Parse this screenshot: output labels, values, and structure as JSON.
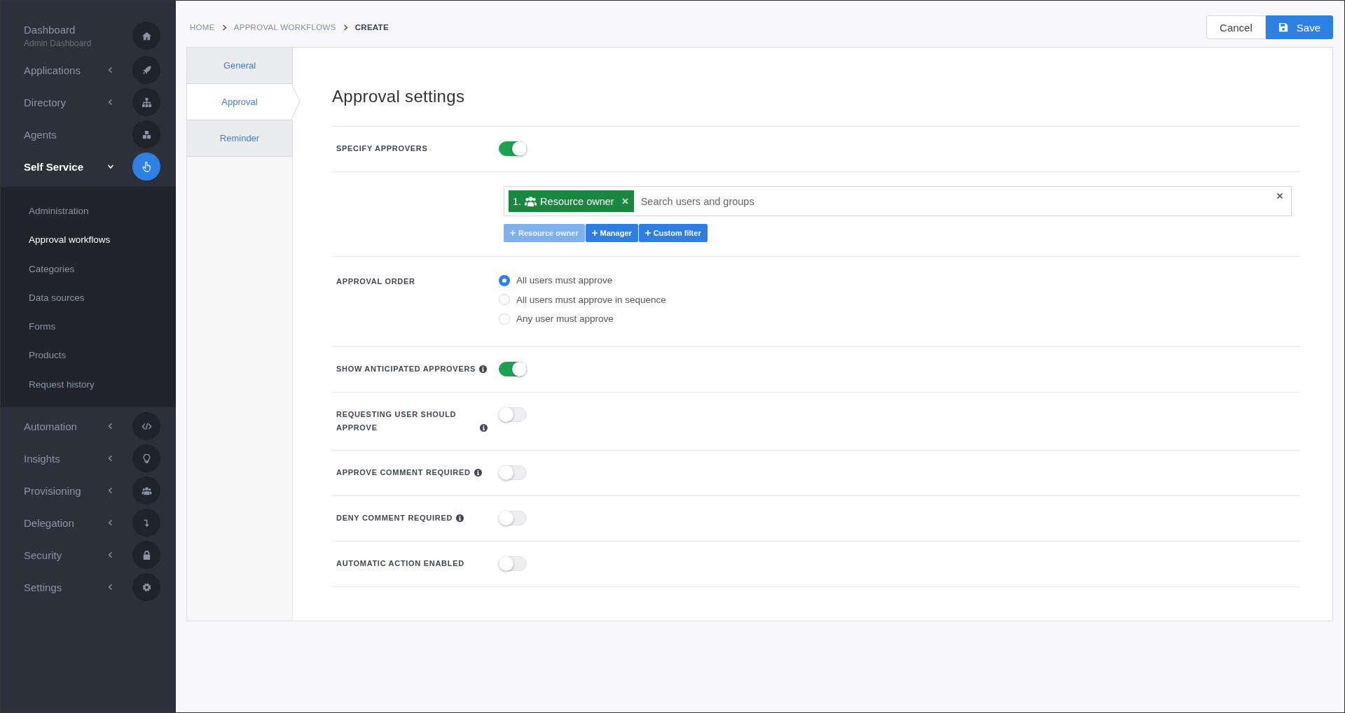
{
  "sidebar": {
    "items": [
      {
        "label": "Dashboard",
        "subtitle": "Admin Dashboard",
        "kind": "link",
        "selected": false
      },
      {
        "label": "Applications",
        "kind": "group",
        "expanded": false,
        "selected": false
      },
      {
        "label": "Directory",
        "kind": "group",
        "expanded": false,
        "selected": false
      },
      {
        "label": "Agents",
        "kind": "link",
        "selected": false
      },
      {
        "label": "Self Service",
        "kind": "group",
        "expanded": true,
        "selected": true,
        "children": [
          {
            "label": "Administration",
            "selected": false
          },
          {
            "label": "Approval workflows",
            "selected": true
          },
          {
            "label": "Categories",
            "selected": false
          },
          {
            "label": "Data sources",
            "selected": false
          },
          {
            "label": "Forms",
            "selected": false
          },
          {
            "label": "Products",
            "selected": false
          },
          {
            "label": "Request history",
            "selected": false
          }
        ]
      },
      {
        "label": "Automation",
        "kind": "group",
        "expanded": false,
        "selected": false
      },
      {
        "label": "Insights",
        "kind": "group",
        "expanded": false,
        "selected": false
      },
      {
        "label": "Provisioning",
        "kind": "group",
        "expanded": false,
        "selected": false
      },
      {
        "label": "Delegation",
        "kind": "group",
        "expanded": false,
        "selected": false
      },
      {
        "label": "Security",
        "kind": "group",
        "expanded": false,
        "selected": false
      },
      {
        "label": "Settings",
        "kind": "group",
        "expanded": false,
        "selected": false
      }
    ]
  },
  "breadcrumb": [
    {
      "label": "HOME",
      "current": false
    },
    {
      "label": "APPROVAL WORKFLOWS",
      "current": false
    },
    {
      "label": "CREATE",
      "current": true
    }
  ],
  "actions": {
    "cancel": "Cancel",
    "save": "Save"
  },
  "tabs": [
    {
      "label": "General",
      "selected": false
    },
    {
      "label": "Approval",
      "selected": true
    },
    {
      "label": "Reminder",
      "selected": false
    }
  ],
  "settings": {
    "title": "Approval settings",
    "rows": [
      {
        "kind": "toggle",
        "label": "SPECIFY APPROVERS",
        "info": false,
        "on": true
      },
      {
        "kind": "approvers",
        "tags": [
          {
            "number": "1.",
            "label": "Resource owner"
          }
        ],
        "placeholder": "Search users and groups",
        "add_buttons": [
          {
            "label": "Resource owner",
            "disabled": true
          },
          {
            "label": "Manager",
            "disabled": false
          },
          {
            "label": "Custom filter",
            "disabled": false
          }
        ]
      },
      {
        "kind": "radio",
        "label": "APPROVAL ORDER",
        "options": [
          {
            "label": "All users must approve",
            "selected": true
          },
          {
            "label": "All users must approve in sequence",
            "selected": false
          },
          {
            "label": "Any user must approve",
            "selected": false
          }
        ]
      },
      {
        "kind": "toggle",
        "label": "SHOW ANTICIPATED APPROVERS",
        "info": true,
        "on": true
      },
      {
        "kind": "toggle",
        "label": "REQUESTING USER SHOULD APPROVE",
        "info": true,
        "on": false
      },
      {
        "kind": "toggle",
        "label": "APPROVE COMMENT REQUIRED",
        "info": true,
        "on": false
      },
      {
        "kind": "toggle",
        "label": "DENY COMMENT REQUIRED",
        "info": true,
        "on": false
      },
      {
        "kind": "toggle",
        "label": "AUTOMATIC ACTION ENABLED",
        "info": false,
        "on": false
      }
    ]
  }
}
